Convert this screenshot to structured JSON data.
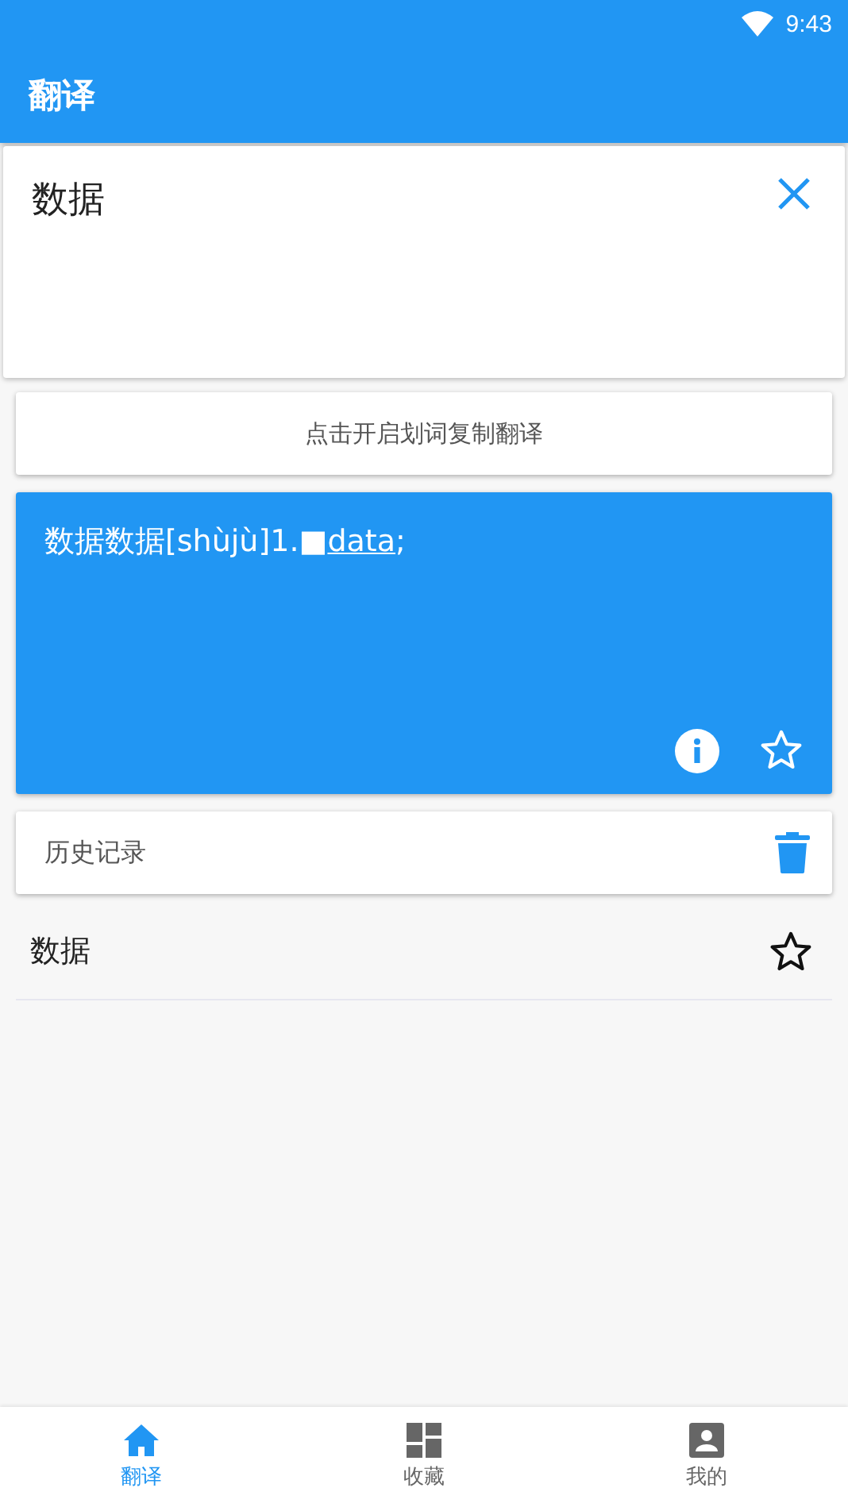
{
  "status_bar": {
    "time": "9:43"
  },
  "app_bar": {
    "title": "翻译"
  },
  "input": {
    "value": "数据"
  },
  "copy_toggle": {
    "label": "点击开启划词复制翻译"
  },
  "result": {
    "text": "数据数据[shùjù]1.■",
    "link": "data",
    "suffix": ";",
    "starred": false
  },
  "history": {
    "title": "历史记录",
    "items": [
      {
        "word": "数据",
        "starred": false
      }
    ]
  },
  "bottom_nav": [
    {
      "label": "翻译",
      "kind": "home",
      "selected": true
    },
    {
      "label": "收藏",
      "kind": "dashboard",
      "selected": false
    },
    {
      "label": "我的",
      "kind": "account",
      "selected": false
    }
  ]
}
